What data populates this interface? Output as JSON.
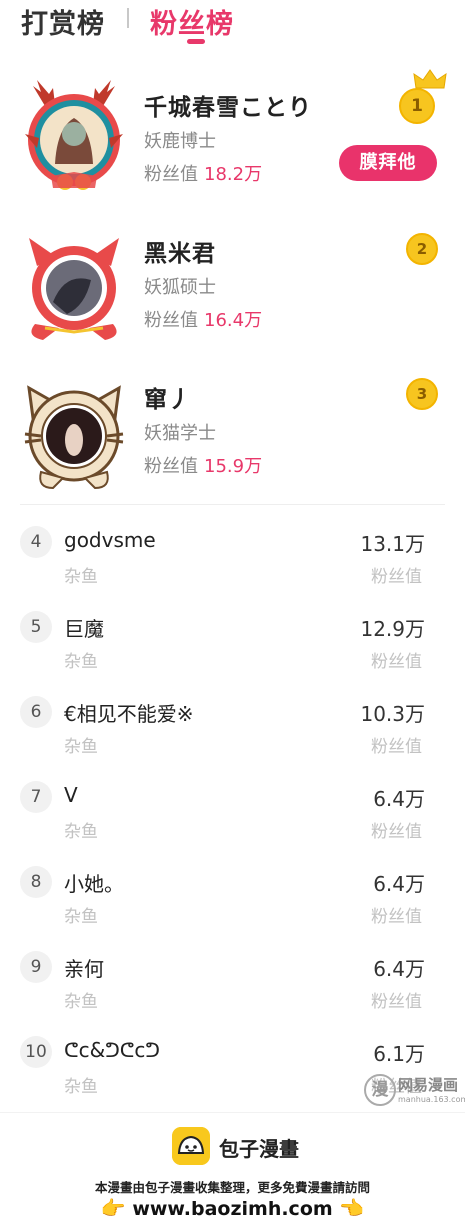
{
  "tabs": {
    "reward": "打赏榜",
    "fans": "粉丝榜"
  },
  "fans_value_label": "粉丝值",
  "worship_button": "膜拜他",
  "top3": [
    {
      "rank": "1",
      "name": "千城春雪ことり",
      "title": "妖鹿博士",
      "fans": "18.2万"
    },
    {
      "rank": "2",
      "name": "黑米君",
      "title": "妖狐硕士",
      "fans": "16.4万"
    },
    {
      "rank": "3",
      "name": "窜丿",
      "title": "妖猫学士",
      "fans": "15.9万"
    }
  ],
  "list": [
    {
      "rank": "4",
      "name": "godvsme",
      "tag": "杂鱼",
      "value": "13.1万",
      "label": "粉丝值"
    },
    {
      "rank": "5",
      "name": "巨魔",
      "tag": "杂鱼",
      "value": "12.9万",
      "label": "粉丝值"
    },
    {
      "rank": "6",
      "name": "€相见不能爱※",
      "tag": "杂鱼",
      "value": "10.3万",
      "label": "粉丝值"
    },
    {
      "rank": "7",
      "name": "V",
      "tag": "杂鱼",
      "value": "6.4万",
      "label": "粉丝值"
    },
    {
      "rank": "8",
      "name": "小她。",
      "tag": "杂鱼",
      "value": "6.4万",
      "label": "粉丝值"
    },
    {
      "rank": "9",
      "name": "亲何",
      "tag": "杂鱼",
      "value": "6.4万",
      "label": "粉丝值"
    },
    {
      "rank": "10",
      "name": "ᕦc&ᕤᕦcᕤ",
      "tag": "杂鱼",
      "value": "6.1万",
      "label": "粉丝值"
    }
  ],
  "watermark": {
    "title": "网易漫画",
    "url": "manhua.163.com",
    "glyph": "漫"
  },
  "footer": {
    "brand": "包子漫畫",
    "note": "本漫畫由包子漫畫收集整理，更多免費漫畫請訪問",
    "url": "www.baozimh.com",
    "hand_left": "👉",
    "hand_right": "👈"
  },
  "colors": {
    "accent": "#e8386a",
    "medal": "#f7c51f",
    "muted": "#c2c2c2"
  }
}
